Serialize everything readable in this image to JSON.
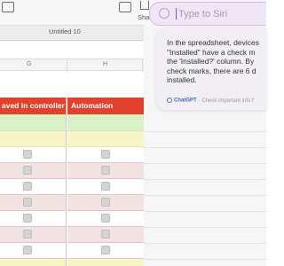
{
  "toolbar": {
    "share_label": "Share"
  },
  "document": {
    "title": "Untitled 10"
  },
  "column_headers": {
    "g": "G",
    "h": "H"
  },
  "table": {
    "headers": [
      "aved in controller",
      "Automation"
    ],
    "rows": [
      {
        "style": "green",
        "checkboxes": false
      },
      {
        "style": "yellow",
        "checkboxes": false
      },
      {
        "style": "white",
        "checkboxes": true
      },
      {
        "style": "pink",
        "checkboxes": true
      },
      {
        "style": "white",
        "checkboxes": true
      },
      {
        "style": "pink",
        "checkboxes": true
      },
      {
        "style": "white",
        "checkboxes": true
      },
      {
        "style": "pink",
        "checkboxes": true
      },
      {
        "style": "white",
        "checkboxes": true
      },
      {
        "style": "yellow",
        "checkboxes": false
      }
    ]
  },
  "siri": {
    "placeholder": "Type to Siri"
  },
  "answer": {
    "lines": [
      "In the spreadsheet, devices",
      "\"Installed\" have a check m",
      "the 'Installed?' column. By",
      "check marks, there are 6 d",
      "installed."
    ],
    "source_label": "ChatGPT",
    "disclaimer": "· Check important info f"
  },
  "colors": {
    "header_red": "#e2412c",
    "siri_border": "#d9b6f0",
    "chatgpt_blue": "#4a5ec0"
  }
}
